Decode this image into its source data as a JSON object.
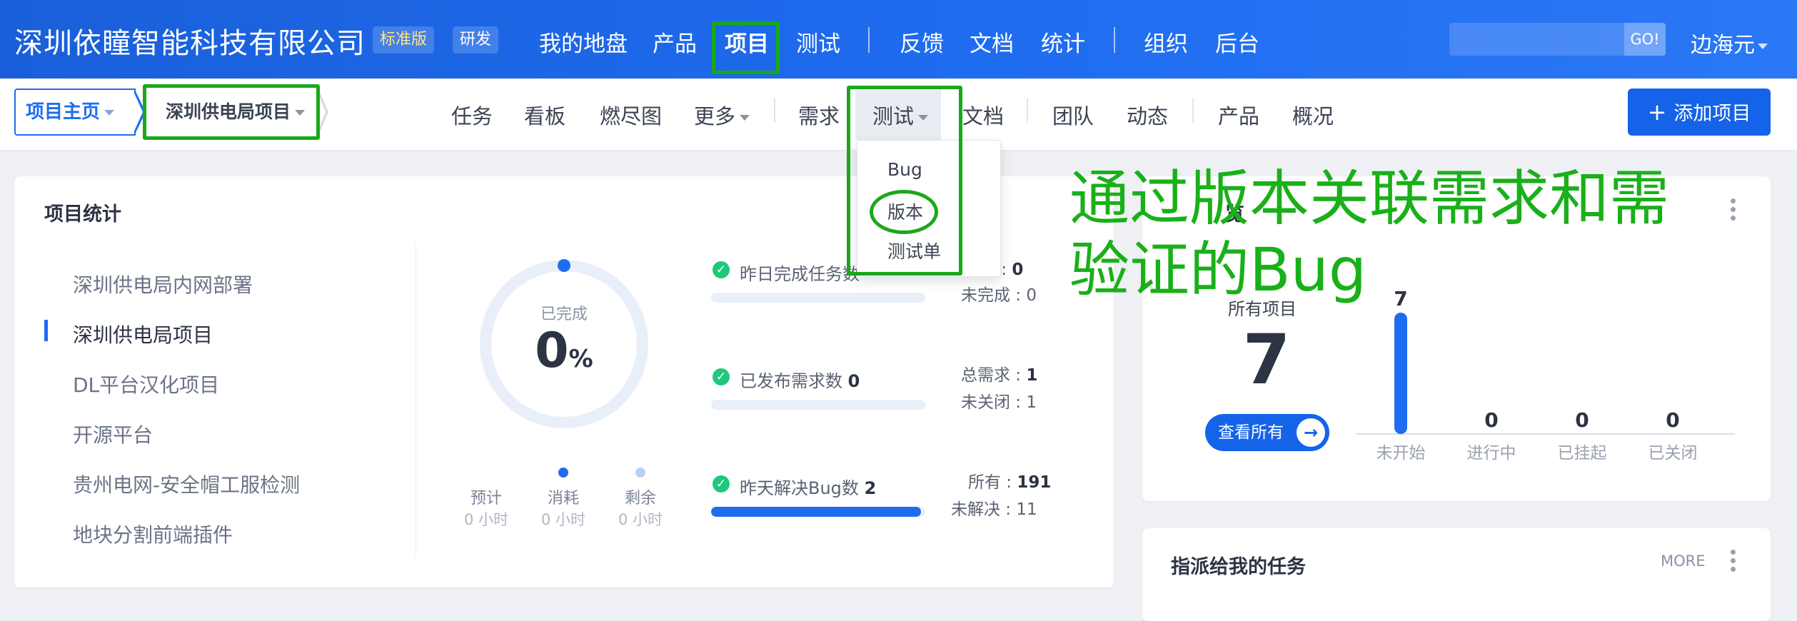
{
  "header": {
    "company": "深圳依瞳智能科技有限公司",
    "edition_badge": "标准版",
    "mode_badge": "研发",
    "nav": [
      "我的地盘",
      "产品",
      "项目",
      "测试",
      "反馈",
      "文档",
      "统计",
      "组织",
      "后台"
    ],
    "active_nav": "项目",
    "search_button": "GO!",
    "user": "边海元"
  },
  "subnav": {
    "home": "项目主页",
    "current_project": "深圳供电局项目",
    "items": [
      "任务",
      "看板",
      "燃尽图",
      "更多",
      "需求",
      "测试",
      "文档",
      "团队",
      "动态",
      "产品",
      "概况"
    ],
    "active_item": "测试",
    "add_button": "添加项目",
    "add_icon": "+"
  },
  "test_dropdown": {
    "items": [
      "Bug",
      "版本",
      "测试单"
    ],
    "highlighted": "版本"
  },
  "annotation": {
    "line1": "通过版本关联需求和需",
    "line2": "验证的Bug",
    "color": "#19b019"
  },
  "project_stats": {
    "title": "项目统计",
    "projects": [
      "深圳供电局内网部署",
      "深圳供电局项目",
      "DL平台汉化项目",
      "开源平台",
      "贵州电网-安全帽工服检测",
      "地块分割前端插件"
    ],
    "active_project": "深圳供电局项目",
    "progress": {
      "label": "已完成",
      "value": "0",
      "unit": "%",
      "fraction": 0
    },
    "legend": [
      {
        "label": "预计",
        "value": "0 小时"
      },
      {
        "label": "消耗",
        "value": "0 小时",
        "dot": "#1e6cf0"
      },
      {
        "label": "剩余",
        "value": "0 小时",
        "dot": "#b9d0f5"
      }
    ],
    "metrics": [
      {
        "label": "昨日完成任务数",
        "bar_fraction": 0,
        "side1_label": "务 : ",
        "side1_value": "0",
        "side2_label": "未完成 : ",
        "side2_value": "0"
      },
      {
        "label": "已发布需求数",
        "value": "0",
        "bar_fraction": 0,
        "side1_label": "总需求 : ",
        "side1_value": "1",
        "side2_label": "未关闭 : ",
        "side2_value": "1"
      },
      {
        "label": "昨天解决Bug数",
        "value": "2",
        "bar_fraction": 0.98,
        "side1_label": "所有 : ",
        "side1_value": "191",
        "side2_label": "未解决 : ",
        "side2_value": "11"
      }
    ]
  },
  "project_overview": {
    "title_fragment": "览",
    "all_label": "所有项目",
    "all_count": "7",
    "view_all_button": "查看所有",
    "view_all_icon": "→"
  },
  "chart_data": {
    "type": "bar",
    "categories": [
      "未开始",
      "进行中",
      "已挂起",
      "已关闭"
    ],
    "values": [
      7,
      0,
      0,
      0
    ],
    "color": "#1e6cf0"
  },
  "assigned_tasks": {
    "title": "指派给我的任务",
    "more": "MORE"
  }
}
